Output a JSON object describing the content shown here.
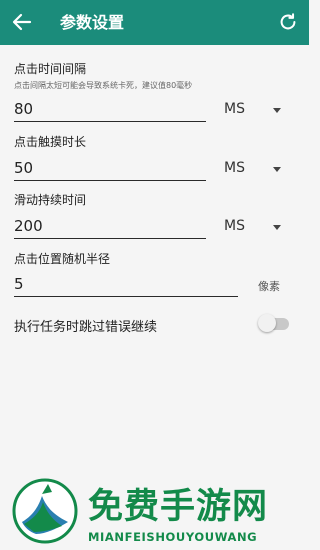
{
  "header": {
    "title": "参数设置",
    "back_icon": "arrow-left-icon",
    "refresh_icon": "refresh-icon",
    "bg_color": "#1b8c7b"
  },
  "settings": {
    "click_interval": {
      "label": "点击时间间隔",
      "hint": "点击间隔太短可能会导致系统卡死，建议值80毫秒",
      "value": "80",
      "unit": "MS"
    },
    "touch_duration": {
      "label": "点击触摸时长",
      "value": "50",
      "unit": "MS"
    },
    "swipe_duration": {
      "label": "滑动持续时间",
      "value": "200",
      "unit": "MS"
    },
    "random_radius": {
      "label": "点击位置随机半径",
      "value": "5",
      "unit": "像素"
    },
    "skip_error": {
      "label": "执行任务时跳过错误继续",
      "enabled": false
    }
  },
  "watermark": {
    "cn": "免费手游网",
    "en": "MIANFEISHOUYOUWANG"
  }
}
